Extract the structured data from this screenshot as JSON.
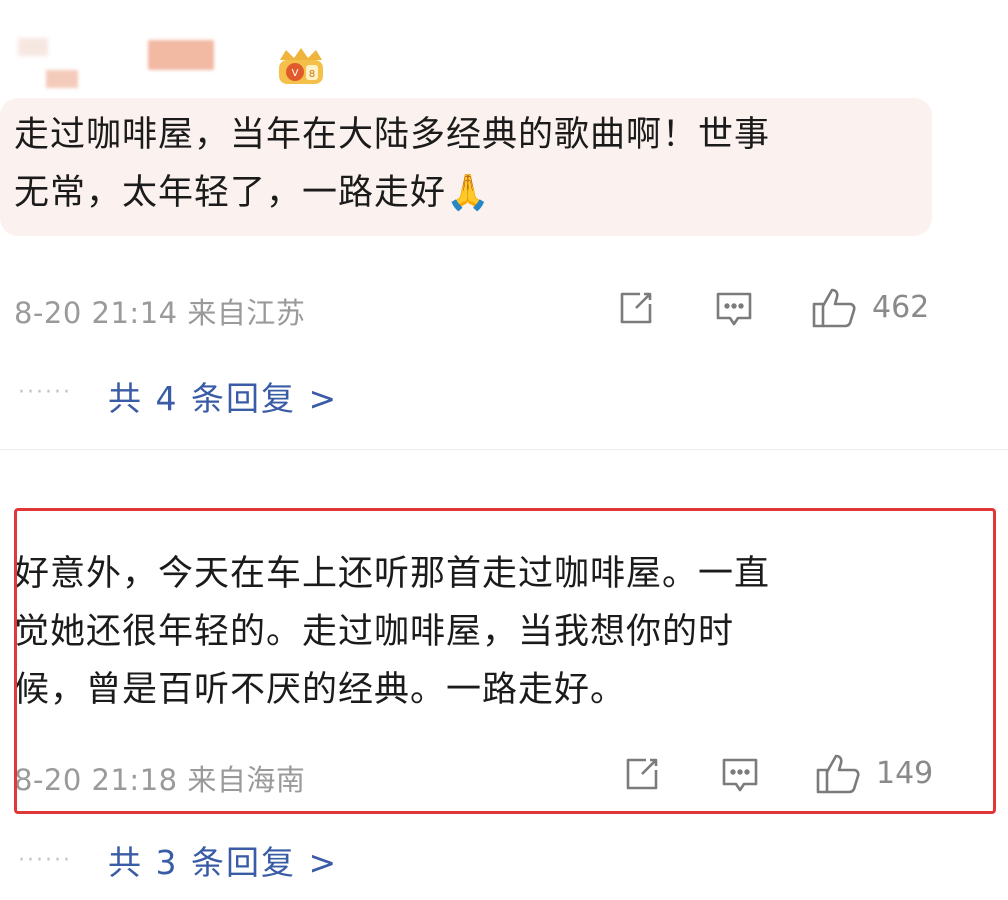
{
  "comments": [
    {
      "text_lines": [
        "走过咖啡屋，当年在大陆多经典的歌曲啊！世事",
        "无常，太年轻了，一路走好🙏"
      ],
      "meta": "8-20 21:14 来自江苏",
      "likes": "462",
      "replies": "共 4 条回复 >",
      "icons": [
        "share-icon",
        "comment-icon",
        "like-icon"
      ],
      "badge_icon": "vip-badge-icon"
    },
    {
      "text_lines": [
        "好意外，今天在车上还听那首走过咖啡屋。一直",
        "觉她还很年轻的。走过咖啡屋，当我想你的时",
        "候，曾是百听不厌的经典。一路走好。"
      ],
      "meta": "8-20 21:18 来自海南",
      "likes": "149",
      "replies": "共 3 条回复 >",
      "icons": [
        "share-icon",
        "comment-icon",
        "like-icon"
      ]
    }
  ],
  "dots": "······",
  "colors": {
    "highlight_border": "#e0383a",
    "reply_link": "#3a5ba5",
    "meta_text": "#9a9a9a",
    "bubble_bg": "#fbf2ef"
  }
}
